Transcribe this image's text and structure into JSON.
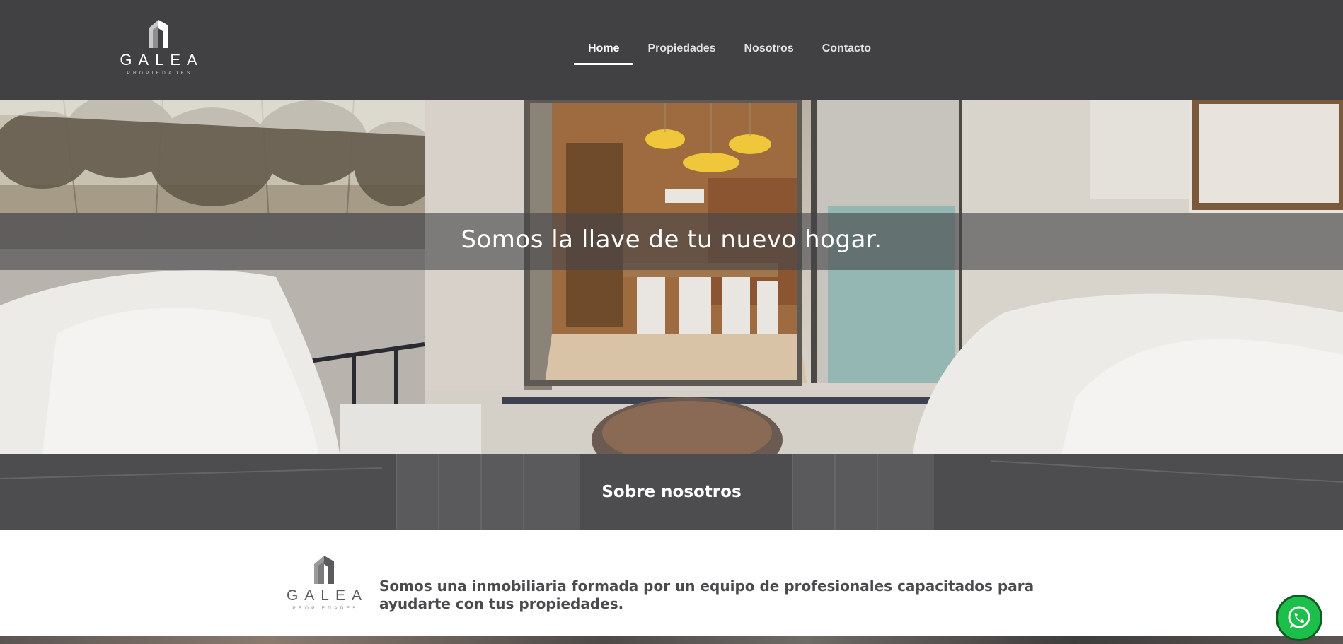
{
  "header": {
    "logo": {
      "name": "GALEA",
      "sub": "PROPIEDADES"
    },
    "nav": [
      {
        "label": "Home",
        "active": true
      },
      {
        "label": "Propiedades",
        "active": false
      },
      {
        "label": "Nosotros",
        "active": false
      },
      {
        "label": "Contacto",
        "active": false
      }
    ]
  },
  "hero": {
    "title": "Somos la llave de tu nuevo hogar."
  },
  "about": {
    "title": "Sobre nosotros",
    "logo": {
      "name": "GALEA",
      "sub": "PROPIEDADES"
    },
    "text": "Somos una inmobiliaria formada por un equipo de profesionales capacitados para ayudarte con tus propiedades."
  },
  "whatsapp": {
    "icon": "whatsapp-icon"
  },
  "colors": {
    "header_bg": "#414042",
    "band_bg": "#4a4a4c",
    "whatsapp": "#1dbf4b",
    "text_dark": "#4b4b4d"
  }
}
